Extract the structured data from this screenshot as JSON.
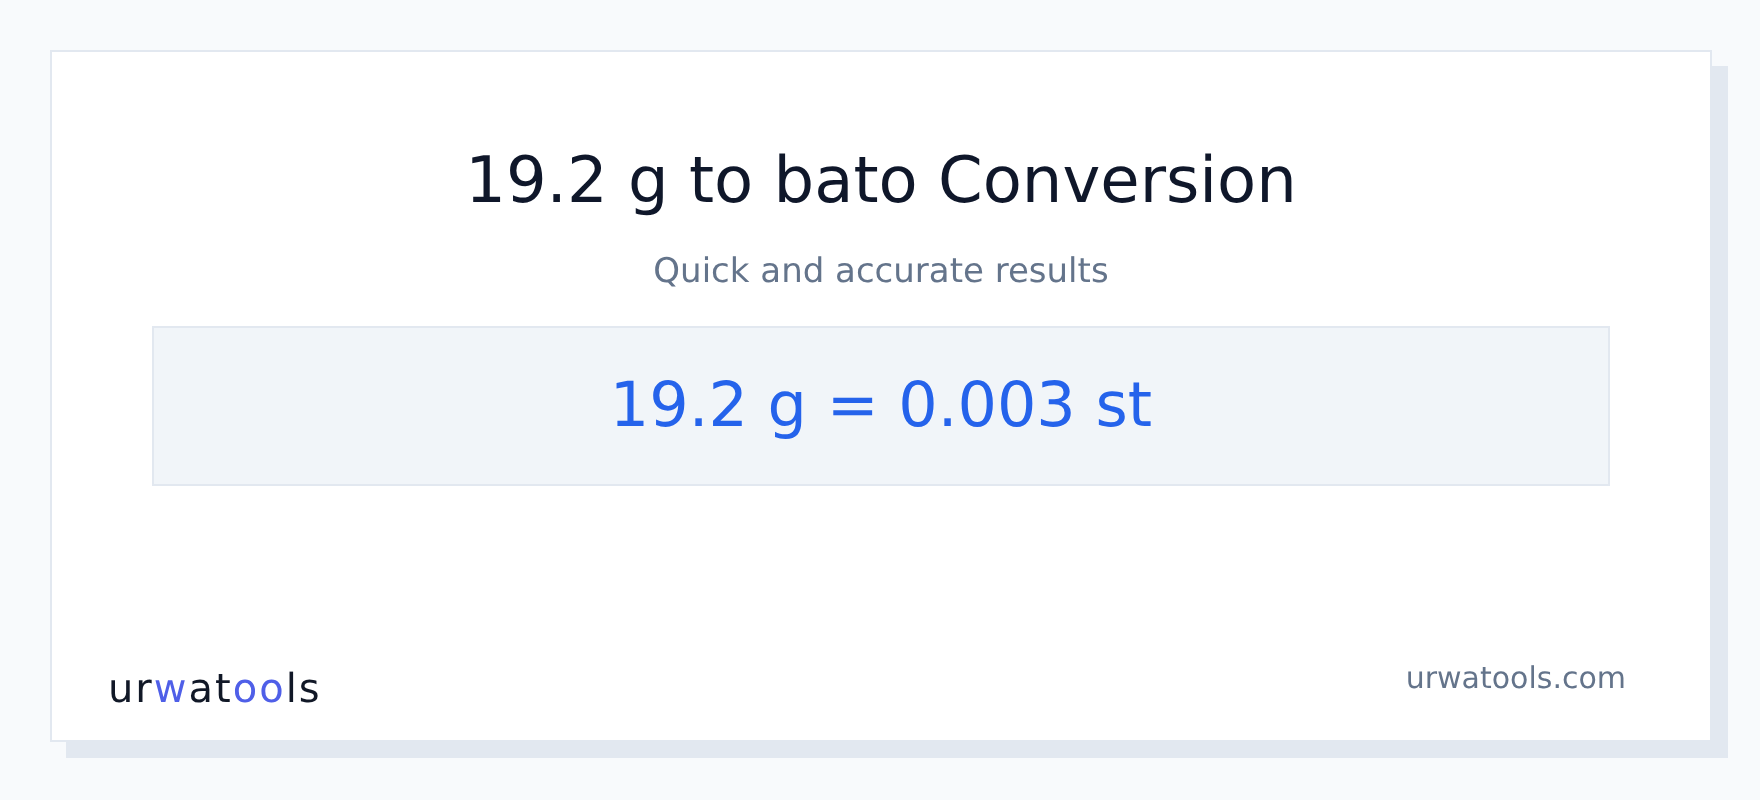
{
  "title": "19.2 g to bato Conversion",
  "subtitle": "Quick and accurate results",
  "result": "19.2 g = 0.003 st",
  "logo": [
    {
      "text": "ur",
      "accent": false
    },
    {
      "text": "w",
      "accent": true
    },
    {
      "text": "at",
      "accent": false
    },
    {
      "text": "oo",
      "accent": true
    },
    {
      "text": "ls",
      "accent": false
    }
  ],
  "site": "urwatools.com"
}
